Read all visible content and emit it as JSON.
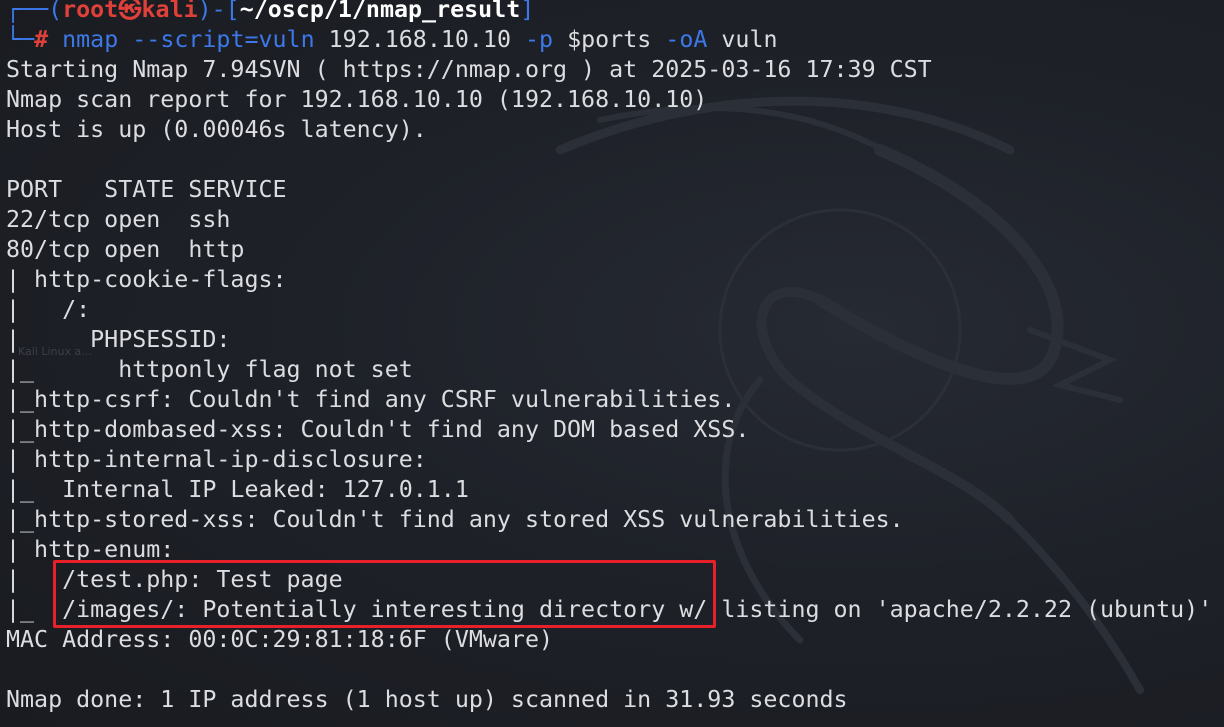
{
  "prompt": {
    "open": "┌──(",
    "user": "root",
    "skull": "㉿",
    "host": "kali",
    "mid": ")-[",
    "path": "~/oscp/1/nmap_result",
    "close": "]",
    "corner": "└─",
    "hash": "#"
  },
  "command": {
    "program": "nmap",
    "arg1": "--script=vuln",
    "target": "192.168.10.10",
    "flag_p": "-p",
    "ports_var": "$ports",
    "flag_oa": "-oA",
    "outfile": "vuln"
  },
  "output_lines": [
    "Starting Nmap 7.94SVN ( https://nmap.org ) at 2025-03-16 17:39 CST",
    "Nmap scan report for 192.168.10.10 (192.168.10.10)",
    "Host is up (0.00046s latency).",
    "",
    "PORT   STATE SERVICE",
    "22/tcp open  ssh",
    "80/tcp open  http",
    "| http-cookie-flags: ",
    "|   /: ",
    "|     PHPSESSID: ",
    "|_      httponly flag not set",
    "|_http-csrf: Couldn't find any CSRF vulnerabilities.",
    "|_http-dombased-xss: Couldn't find any DOM based XSS.",
    "| http-internal-ip-disclosure: ",
    "|_  Internal IP Leaked: 127.0.1.1",
    "|_http-stored-xss: Couldn't find any stored XSS vulnerabilities.",
    "| http-enum: ",
    "|   /test.php: Test page",
    "|_  /images/: Potentially interesting directory w/ listing on 'apache/2.2.22 (ubuntu)'",
    "MAC Address: 00:0C:29:81:18:6F (VMware)",
    "",
    "Nmap done: 1 IP address (1 host up) scanned in 31.93 seconds"
  ],
  "watermark": "Kali Linux a...",
  "colors": {
    "background": "#1b1d22",
    "text": "#dcdde0",
    "prompt_blue": "#3c78e8",
    "prompt_red": "#e0403a",
    "highlight_box": "#e8202a"
  }
}
